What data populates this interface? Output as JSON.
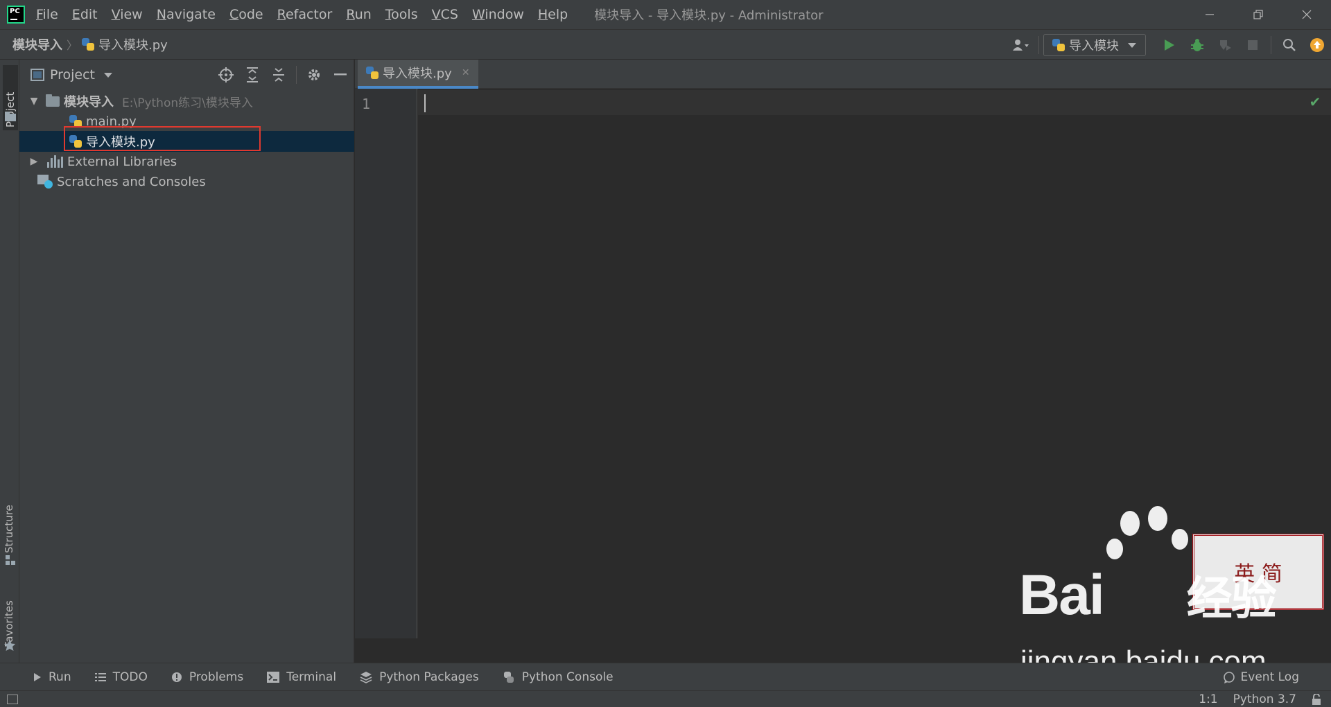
{
  "app": {
    "menu": [
      "File",
      "Edit",
      "View",
      "Navigate",
      "Code",
      "Refactor",
      "Run",
      "Tools",
      "VCS",
      "Window",
      "Help"
    ],
    "window_title": "模块导入 - 导入模块.py - Administrator"
  },
  "breadcrumb": {
    "project": "模块导入",
    "file": "导入模块.py"
  },
  "toolbar": {
    "run_config": "导入模块",
    "icons": [
      "user-icon",
      "run-icon",
      "debug-icon",
      "coverage-icon",
      "stop-icon",
      "search-icon",
      "update-icon"
    ]
  },
  "left_strip": {
    "project_tab": "Project",
    "structure_tab": "Structure",
    "favorites_tab": "Favorites"
  },
  "project_panel": {
    "title": "Project",
    "root": {
      "name": "模块导入",
      "path": "E:\\Python练习\\模块导入"
    },
    "files": [
      "main.py",
      "导入模块.py"
    ],
    "selected_file": "导入模块.py",
    "external_libraries": "External Libraries",
    "scratches": "Scratches and Consoles"
  },
  "editor": {
    "tab_label": "导入模块.py",
    "line_number": "1"
  },
  "bottom_tools": {
    "run": "Run",
    "todo": "TODO",
    "problems": "Problems",
    "terminal": "Terminal",
    "python_packages": "Python Packages",
    "python_console": "Python Console",
    "event_log": "Event Log"
  },
  "status": {
    "position": "1:1",
    "interpreter": "Python 3.7"
  },
  "watermark": {
    "brand": "Bai",
    "brand_cn": "经验",
    "url": "jingyan.baidu.com",
    "stamp_text": "英 简"
  },
  "colors": {
    "accent": "#4a88c7",
    "selection": "#0d293e",
    "highlight_box": "#e0392f",
    "run_green": "#499c54"
  }
}
